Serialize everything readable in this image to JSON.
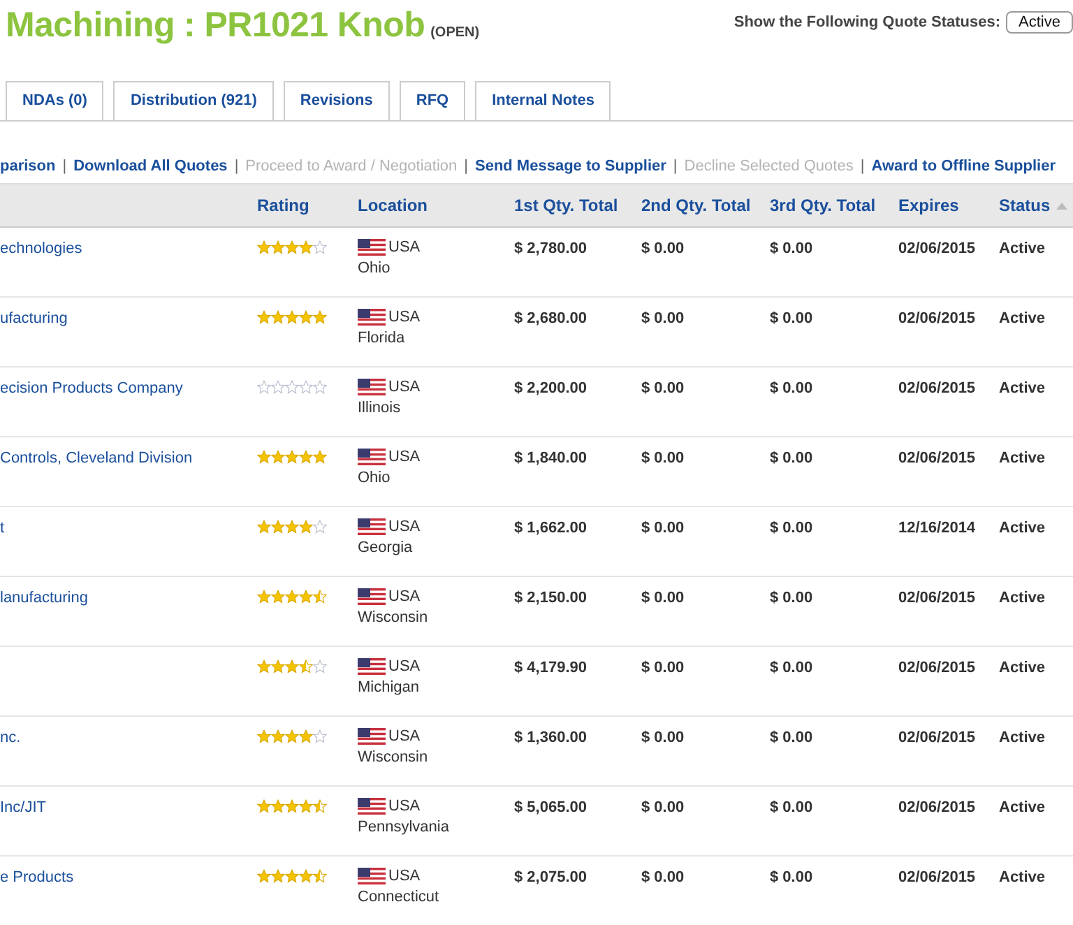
{
  "title": "Machining : PR1021 Knob",
  "title_status": "(OPEN)",
  "status_filter": {
    "label": "Show the Following Quote Statuses:",
    "value": "Active"
  },
  "tabs": [
    {
      "label": "NDAs (0)",
      "selected": false
    },
    {
      "label": "Distribution (921)",
      "selected": false
    },
    {
      "label": "Revisions",
      "selected": false
    },
    {
      "label": "RFQ",
      "selected": false
    },
    {
      "label": "Internal Notes",
      "selected": false
    }
  ],
  "actions": [
    {
      "kind": "link",
      "label": "parison",
      "disabled": false
    },
    {
      "kind": "separator",
      "label": "|"
    },
    {
      "kind": "link",
      "label": "Download All Quotes",
      "disabled": false
    },
    {
      "kind": "separator",
      "label": "|"
    },
    {
      "kind": "link",
      "label": "Proceed to Award / Negotiation",
      "disabled": true
    },
    {
      "kind": "separator",
      "label": "|"
    },
    {
      "kind": "link",
      "label": "Send Message to Supplier",
      "disabled": false
    },
    {
      "kind": "separator",
      "label": "|"
    },
    {
      "kind": "link",
      "label": "Decline Selected Quotes",
      "disabled": true
    },
    {
      "kind": "separator",
      "label": "|"
    },
    {
      "kind": "link",
      "label": "Award to Offline Supplier",
      "disabled": false
    }
  ],
  "table": {
    "columns": [
      {
        "sorted": false
      },
      {
        "label": "Rating",
        "sorted": false
      },
      {
        "label": "Location",
        "sorted": false
      },
      {
        "label": "1st Qty. Total",
        "sorted": false
      },
      {
        "label": "2nd Qty. Total",
        "sorted": false
      },
      {
        "label": "3rd Qty. Total",
        "sorted": false
      },
      {
        "label": "Expires",
        "sorted": false
      },
      {
        "label": "Status",
        "sorted": true
      }
    ],
    "rows": [
      {
        "supplier": "echnologies",
        "stars": 4,
        "country": "USA",
        "state": "Ohio",
        "qty1": "$ 2,780.00",
        "qty2": "$ 0.00",
        "qty3": "$ 0.00",
        "expires": "02/06/2015",
        "status": "Active"
      },
      {
        "supplier": "ufacturing",
        "stars": 5,
        "country": "USA",
        "state": "Florida",
        "qty1": "$ 2,680.00",
        "qty2": "$ 0.00",
        "qty3": "$ 0.00",
        "expires": "02/06/2015",
        "status": "Active"
      },
      {
        "supplier": "ecision Products Company",
        "stars": 0,
        "country": "USA",
        "state": "Illinois",
        "qty1": "$ 2,200.00",
        "qty2": "$ 0.00",
        "qty3": "$ 0.00",
        "expires": "02/06/2015",
        "status": "Active"
      },
      {
        "supplier": "Controls, Cleveland Division",
        "stars": 5,
        "country": "USA",
        "state": "Ohio",
        "qty1": "$ 1,840.00",
        "qty2": "$ 0.00",
        "qty3": "$ 0.00",
        "expires": "02/06/2015",
        "status": "Active"
      },
      {
        "supplier": "t",
        "stars": 4,
        "country": "USA",
        "state": "Georgia",
        "qty1": "$ 1,662.00",
        "qty2": "$ 0.00",
        "qty3": "$ 0.00",
        "expires": "12/16/2014",
        "status": "Active"
      },
      {
        "supplier": "lanufacturing",
        "stars": 4.5,
        "country": "USA",
        "state": "Wisconsin",
        "qty1": "$ 2,150.00",
        "qty2": "$ 0.00",
        "qty3": "$ 0.00",
        "expires": "02/06/2015",
        "status": "Active"
      },
      {
        "stars": 3.5,
        "country": "USA",
        "state": "Michigan",
        "qty1": "$ 4,179.90",
        "qty2": "$ 0.00",
        "qty3": "$ 0.00",
        "expires": "02/06/2015",
        "status": "Active"
      },
      {
        "supplier": "nc.",
        "stars": 4,
        "country": "USA",
        "state": "Wisconsin",
        "qty1": "$ 1,360.00",
        "qty2": "$ 0.00",
        "qty3": "$ 0.00",
        "expires": "02/06/2015",
        "status": "Active"
      },
      {
        "supplier": "Inc/JIT",
        "stars": 4.5,
        "country": "USA",
        "state": "Pennsylvania",
        "qty1": "$ 5,065.00",
        "qty2": "$ 0.00",
        "qty3": "$ 0.00",
        "expires": "02/06/2015",
        "status": "Active"
      },
      {
        "supplier": "e Products",
        "stars": 4.5,
        "country": "USA",
        "state": "Connecticut",
        "qty1": "$ 2,075.00",
        "qty2": "$ 0.00",
        "qty3": "$ 0.00",
        "expires": "02/06/2015",
        "status": "Active"
      }
    ]
  }
}
